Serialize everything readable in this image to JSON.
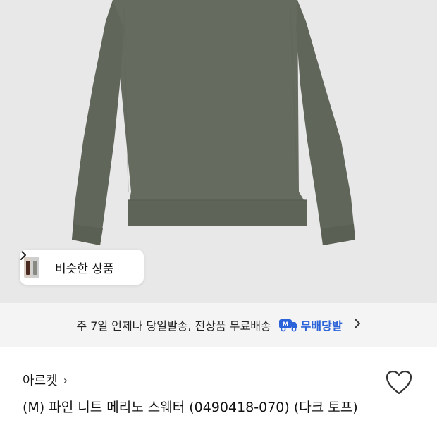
{
  "product_image": {
    "alt": "product-photo-dark-olive-knit-sweater"
  },
  "similar": {
    "label": "비슷한 상품",
    "chevron_icon": "chevron-right-icon"
  },
  "delivery": {
    "text": "주 7일 언제나 당일발송, 전상품 무료배송",
    "badge_icon": "truck-m-icon",
    "badge_label": "무배당발",
    "chevron_icon": "chevron-right-icon"
  },
  "brand": {
    "name": "아르켓",
    "chevron": "›"
  },
  "product": {
    "title": "(M) 파인 니트 메리노 스웨터 (0490418-070) (다크 토프)"
  },
  "colors": {
    "image_bg": "#e8e8e9",
    "sweater": "#666b60",
    "delivery_bg": "#f4f4f5",
    "accent_blue": "#2b63d9"
  }
}
